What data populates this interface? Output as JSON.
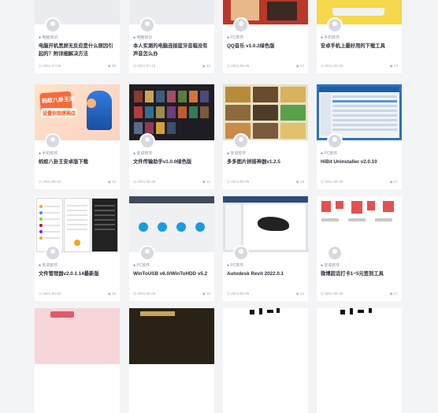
{
  "cards": [
    {
      "category": "电脑常识",
      "title": "电脑开机黑屏无反应是什么原因引起的？附详细解决方法",
      "date": "2021-07-09",
      "views": "38"
    },
    {
      "category": "电脑常识",
      "title": "本人实测的电脑连接蓝牙音箱没有声音怎么办",
      "date": "2021-07-13",
      "views": "24"
    },
    {
      "category": "PC软件",
      "title": "QQ音乐 v1.0.2绿色版",
      "date": "2021-05-28",
      "views": "17"
    },
    {
      "category": "手机软件",
      "title": "安卓手机上最好用的下载工具",
      "date": "2021-05-28",
      "views": "23"
    },
    {
      "category": "手机软件",
      "title": "蚂蚁八卦王安卓版下载",
      "date": "2021-05-29",
      "views": "13"
    },
    {
      "category": "安卓软件",
      "title": "文件传输助手v1.0.0绿色版",
      "date": "2021-05-29",
      "views": "12"
    },
    {
      "category": "安卓软件",
      "title": "多多图片拼接神器v1.2.5",
      "date": "2021-05-29",
      "views": "19"
    },
    {
      "category": "PC软件",
      "title": "HiBit Uninstaller v2.0.10",
      "date": "2021-05-29",
      "views": "27"
    },
    {
      "category": "安卓软件",
      "title": "文件管理器v2.0.1.14最新版",
      "date": "2021-05-29",
      "views": "19"
    },
    {
      "category": "PC软件",
      "title": "WinToUSB v6.0/WinToHDD v5.2",
      "date": "2021-05-29",
      "views": "18"
    },
    {
      "category": "PC软件",
      "title": "Autodesk Revit 2022.0.1",
      "date": "2021-05-29",
      "views": "14"
    },
    {
      "category": "安卓软件",
      "title": "微博超话打卡1~5元签到工具",
      "date": "2021-05-29",
      "views": "17"
    }
  ],
  "thumb_text": {
    "card5_line1": "蚂蚁八卦王来",
    "card5_line2": "设置你到搭购店"
  },
  "colors": {
    "accent": "#3c89f5",
    "page_bg": "#f3f4f6"
  }
}
